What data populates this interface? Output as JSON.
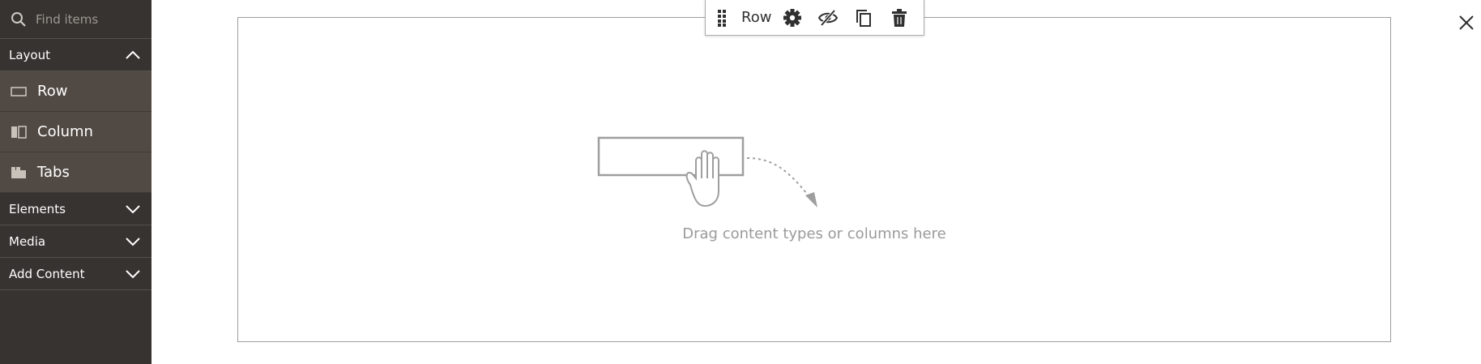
{
  "search": {
    "placeholder": "Find items",
    "icon": "search-icon"
  },
  "sections": {
    "layout": {
      "label": "Layout",
      "expanded": true
    },
    "elements": {
      "label": "Elements",
      "expanded": false
    },
    "media": {
      "label": "Media",
      "expanded": false
    },
    "add_content": {
      "label": "Add Content",
      "expanded": false
    }
  },
  "layout_items": [
    {
      "label": "Row",
      "icon": "row-icon"
    },
    {
      "label": "Column",
      "icon": "column-icon"
    },
    {
      "label": "Tabs",
      "icon": "tabs-icon"
    }
  ],
  "toolbar": {
    "label": "Row",
    "actions": [
      "move-handle-icon",
      "gear-icon",
      "eye-slash-icon",
      "duplicate-icon",
      "trash-icon"
    ]
  },
  "stage": {
    "empty_text": "Drag content types or columns here"
  },
  "colors": {
    "sidebar_bg": "#373330",
    "item_bg": "#514943",
    "text_muted": "#9a9a9a"
  }
}
